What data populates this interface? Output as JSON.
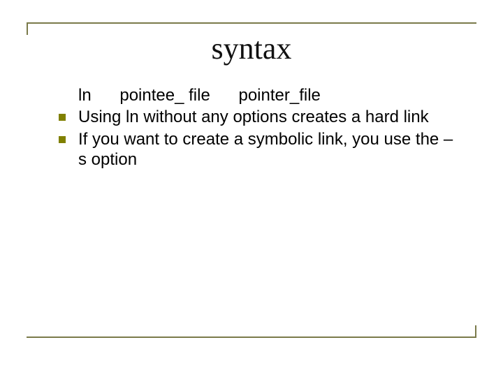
{
  "title": "syntax",
  "syntax_line": {
    "cmd": "ln",
    "arg1": "pointee_ file",
    "arg2": "pointer_file"
  },
  "bullets": [
    "Using ln without any options creates a hard link",
    " If you want to create a symbolic link, you use the –s option"
  ]
}
